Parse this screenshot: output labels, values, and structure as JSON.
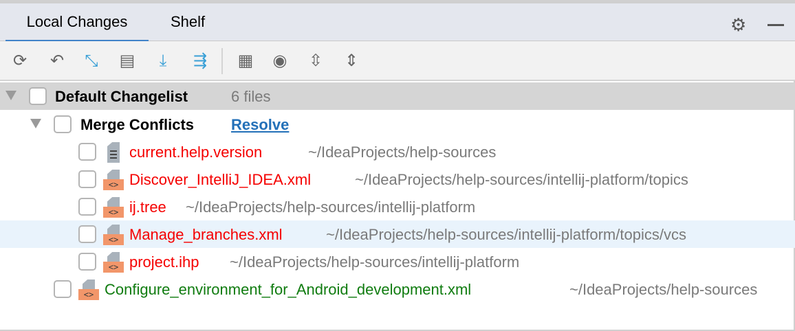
{
  "tabs": [
    {
      "label": "Local Changes",
      "active": true
    },
    {
      "label": "Shelf",
      "active": false
    }
  ],
  "icons": {
    "settings": "gear-icon",
    "hide": "minimize-icon"
  },
  "toolbar": [
    "refresh-icon",
    "rollback-icon",
    "diff-icon",
    "commit-message-icon",
    "update-icon",
    "shelve-icon",
    "group-by-icon",
    "view-options-icon",
    "expand-all-icon",
    "collapse-all-icon"
  ],
  "changelist": {
    "name": "Default Changelist",
    "count": "6 files"
  },
  "merge": {
    "label": "Merge Conflicts",
    "action": "Resolve"
  },
  "files": [
    {
      "name": "current.help.version",
      "path": "~/IdeaProjects/help-sources",
      "type": "text",
      "status": "conflict"
    },
    {
      "name": "Discover_IntelliJ_IDEA.xml",
      "path": "~/IdeaProjects/help-sources/intellij-platform/topics",
      "type": "xml",
      "status": "conflict"
    },
    {
      "name": "ij.tree",
      "path": "~/IdeaProjects/help-sources/intellij-platform",
      "type": "xml",
      "status": "conflict"
    },
    {
      "name": "Manage_branches.xml",
      "path": "~/IdeaProjects/help-sources/intellij-platform/topics/vcs",
      "type": "xml",
      "status": "conflict"
    },
    {
      "name": "project.ihp",
      "path": "~/IdeaProjects/help-sources/intellij-platform",
      "type": "xml",
      "status": "conflict"
    }
  ],
  "added": {
    "name": "Configure_environment_for_Android_development.xml",
    "path": "~/IdeaProjects/help-sources",
    "type": "xml",
    "status": "added"
  },
  "colors": {
    "conflict": "#f50000",
    "added": "#107c10",
    "accent": "#4083c9",
    "link": "#2370b8"
  }
}
